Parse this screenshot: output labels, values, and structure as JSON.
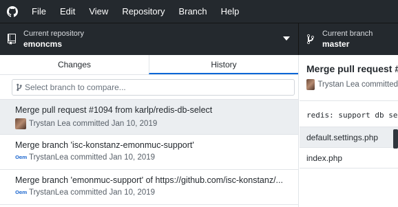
{
  "menu": {
    "items": [
      "File",
      "Edit",
      "View",
      "Repository",
      "Branch",
      "Help"
    ]
  },
  "toolbar": {
    "repo_label": "Current repository",
    "repo_value": "emoncms",
    "branch_label": "Current branch",
    "branch_value": "master"
  },
  "tabs": {
    "changes": "Changes",
    "history": "History"
  },
  "compare": {
    "placeholder": "Select branch to compare..."
  },
  "commits": [
    {
      "title": "Merge pull request #1094 from karlp/redis-db-select",
      "meta": "Trystan Lea committed Jan 10, 2019"
    },
    {
      "title": "Merge branch 'isc-konstanz-emonmuc-support'",
      "meta": "TrystanLea committed Jan 10, 2019"
    },
    {
      "title": "Merge branch 'emonmuc-support' of https://github.com/isc-konstanz/...",
      "meta": "TrystanLea committed Jan 10, 2019"
    }
  ],
  "detail": {
    "title": "Merge pull request #",
    "meta": "Trystan Lea committed",
    "body": "redis: support db sele",
    "files": [
      "default.settings.php",
      "index.php"
    ]
  },
  "colors": {
    "titlebar": "#24292e",
    "accent": "#0366d6",
    "selected": "#ebeef1"
  },
  "avatar_text": "Oem"
}
